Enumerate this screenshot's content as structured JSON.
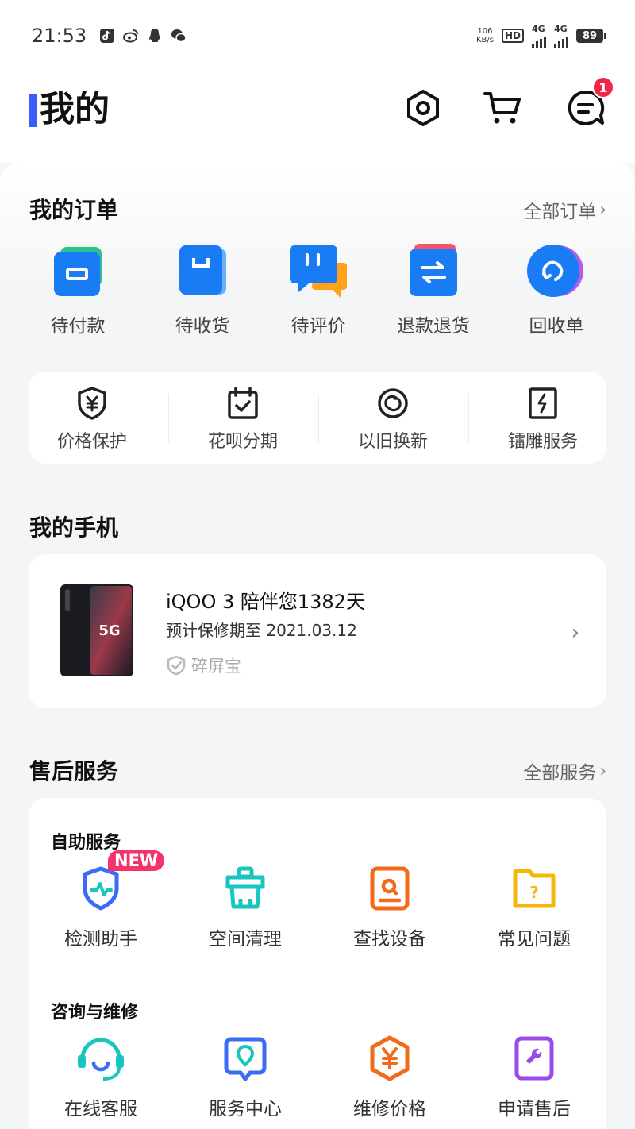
{
  "status_bar": {
    "time": "21:53",
    "net_speed_value": "106",
    "net_speed_unit": "KB/s",
    "hd_label": "HD",
    "sim1_label": "4G",
    "sim2_label": "4G",
    "battery": "89",
    "notification_icons": [
      "tiktok-icon",
      "weibo-icon",
      "qq-icon",
      "wechat-icon"
    ]
  },
  "header": {
    "title": "我的",
    "message_badge": "1",
    "accent_color": "#3b5bfa"
  },
  "orders": {
    "title": "我的订单",
    "all_link": "全部订单",
    "items": [
      {
        "label": "待付款",
        "icon": "wallet-icon"
      },
      {
        "label": "待收货",
        "icon": "box-icon"
      },
      {
        "label": "待评价",
        "icon": "comment-icon"
      },
      {
        "label": "退款退货",
        "icon": "refund-icon"
      },
      {
        "label": "回收单",
        "icon": "recycle-icon"
      }
    ],
    "perks": [
      {
        "label": "价格保护",
        "icon": "price-protect-icon"
      },
      {
        "label": "花呗分期",
        "icon": "installment-icon"
      },
      {
        "label": "以旧换新",
        "icon": "trade-in-icon"
      },
      {
        "label": "镭雕服务",
        "icon": "laser-engrave-icon"
      }
    ]
  },
  "my_phone": {
    "title": "我的手机",
    "name": "iQOO 3 陪伴您1382天",
    "warranty": "预计保修期至 2021.03.12",
    "plan": "碎屏宝",
    "phone_badge": "5G"
  },
  "after_sales": {
    "title": "售后服务",
    "all_link": "全部服务",
    "self_service": {
      "title": "自助服务",
      "new_tag": "NEW",
      "items": [
        {
          "label": "检测助手",
          "icon": "diagnose-icon",
          "color": "#3b6cf6"
        },
        {
          "label": "空间清理",
          "icon": "cleanup-icon",
          "color": "#18c6c0"
        },
        {
          "label": "查找设备",
          "icon": "find-device-icon",
          "color": "#f26a1b"
        },
        {
          "label": "常见问题",
          "icon": "faq-icon",
          "color": "#f5b70a"
        }
      ]
    },
    "consult": {
      "title": "咨询与维修",
      "items": [
        {
          "label": "在线客服",
          "icon": "headset-icon",
          "color": "#18c6c0"
        },
        {
          "label": "服务中心",
          "icon": "location-icon",
          "color": "#3b6cf6"
        },
        {
          "label": "维修价格",
          "icon": "repair-price-icon",
          "color": "#f26a1b"
        },
        {
          "label": "申请售后",
          "icon": "wrench-icon",
          "color": "#9b4be8"
        }
      ]
    }
  }
}
